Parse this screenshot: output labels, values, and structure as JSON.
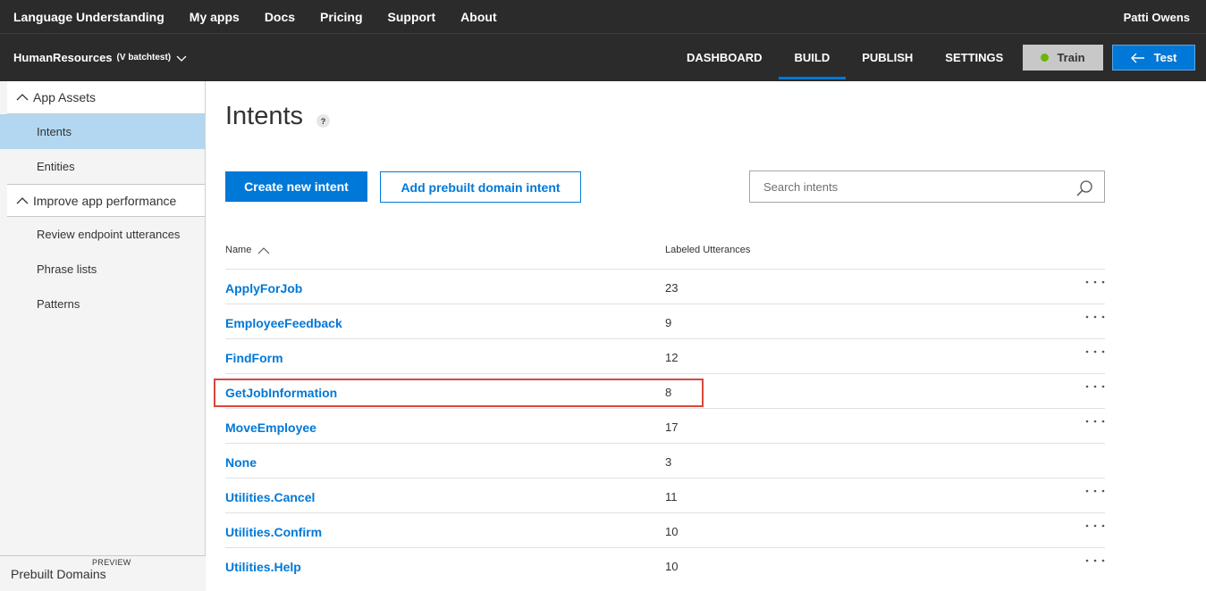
{
  "topnav": {
    "brand": "Language Understanding",
    "links": [
      "My apps",
      "Docs",
      "Pricing",
      "Support",
      "About"
    ],
    "user": "Patti Owens"
  },
  "appbar": {
    "app_name": "HumanResources",
    "version": "(V batchtest)",
    "tabs": [
      {
        "label": "DASHBOARD",
        "active": false
      },
      {
        "label": "BUILD",
        "active": true
      },
      {
        "label": "PUBLISH",
        "active": false
      },
      {
        "label": "SETTINGS",
        "active": false
      }
    ],
    "train_label": "Train",
    "test_label": "Test",
    "accent": "#0078d7",
    "status_color": "#6bb700"
  },
  "sidebar": {
    "sections": [
      {
        "label": "App Assets",
        "items": [
          {
            "label": "Intents",
            "active": true
          },
          {
            "label": "Entities",
            "active": false
          }
        ]
      },
      {
        "label": "Improve app performance",
        "items": [
          {
            "label": "Review endpoint utterances",
            "active": false
          },
          {
            "label": "Phrase lists",
            "active": false
          },
          {
            "label": "Patterns",
            "active": false
          }
        ]
      }
    ],
    "bottom": {
      "title": "Prebuilt Domains",
      "badge": "PREVIEW"
    }
  },
  "main": {
    "title": "Intents",
    "help": "?",
    "create_label": "Create new intent",
    "prebuilt_label": "Add prebuilt domain intent",
    "search_placeholder": "Search intents",
    "columns": {
      "name": "Name",
      "utterances": "Labeled Utterances"
    },
    "rows": [
      {
        "name": "ApplyForJob",
        "count": "23",
        "more": true
      },
      {
        "name": "EmployeeFeedback",
        "count": "9",
        "more": true
      },
      {
        "name": "FindForm",
        "count": "12",
        "more": true
      },
      {
        "name": "GetJobInformation",
        "count": "8",
        "more": true,
        "highlighted": true
      },
      {
        "name": "MoveEmployee",
        "count": "17",
        "more": true
      },
      {
        "name": "None",
        "count": "3",
        "more": false
      },
      {
        "name": "Utilities.Cancel",
        "count": "11",
        "more": true
      },
      {
        "name": "Utilities.Confirm",
        "count": "10",
        "more": true
      },
      {
        "name": "Utilities.Help",
        "count": "10",
        "more": true
      }
    ],
    "highlight_color": "#d9473b"
  }
}
